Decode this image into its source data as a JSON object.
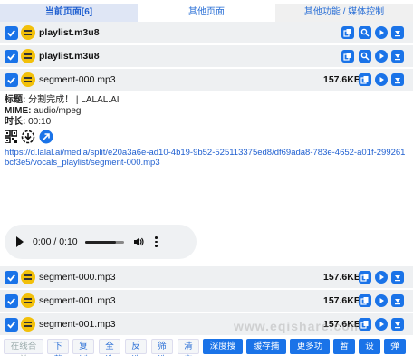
{
  "tabs": [
    "当前页面[6]",
    "其他页面",
    "其他功能 / 媒体控制"
  ],
  "rows": [
    {
      "name": "playlist.m3u8",
      "size": ""
    },
    {
      "name": "playlist.m3u8",
      "size": ""
    },
    {
      "name": "segment-000.mp3",
      "size": "157.6KB"
    },
    {
      "name": "segment-000.mp3",
      "size": "157.6KB"
    },
    {
      "name": "segment-001.mp3",
      "size": "157.6KB"
    },
    {
      "name": "segment-001.mp3",
      "size": "157.6KB"
    }
  ],
  "detail": {
    "title_label": "标题:",
    "title_value": " 分割完成！ | LALAL.AI",
    "mime_label": "MIME:",
    "mime_value": " audio/mpeg",
    "duration_label": "时长:",
    "duration_value": " 00:10",
    "url": "https://d.lalal.ai/media/split/e20a3a6e-ad10-4b19-9b52-525113375ed8/df69ada8-783e-4652-a01f-299261bcf3e5/vocals_playlist/segment-000.mp3"
  },
  "player": {
    "time": "0:00 / 0:10",
    "progress": 0.0
  },
  "bottom_buttons": [
    "在线合并",
    "下载",
    "复制",
    "全选",
    "反选",
    "筛选",
    "清空",
    "深度搜索",
    "缓存捕捉",
    "更多功能",
    "暂停",
    "设置",
    "弹出"
  ],
  "watermark": "www.eqishare.com",
  "icons": [
    "checkbox-icon",
    "equalizer-icon",
    "copy-icon",
    "search-icon",
    "play-icon",
    "download-icon",
    "qrcode-icon",
    "arrow-icon"
  ],
  "colors": {
    "accent": "#1a73e8",
    "row_bg": "#eef0f2",
    "link": "#1f5fd0",
    "eq_yellow": "#f2c00a"
  }
}
